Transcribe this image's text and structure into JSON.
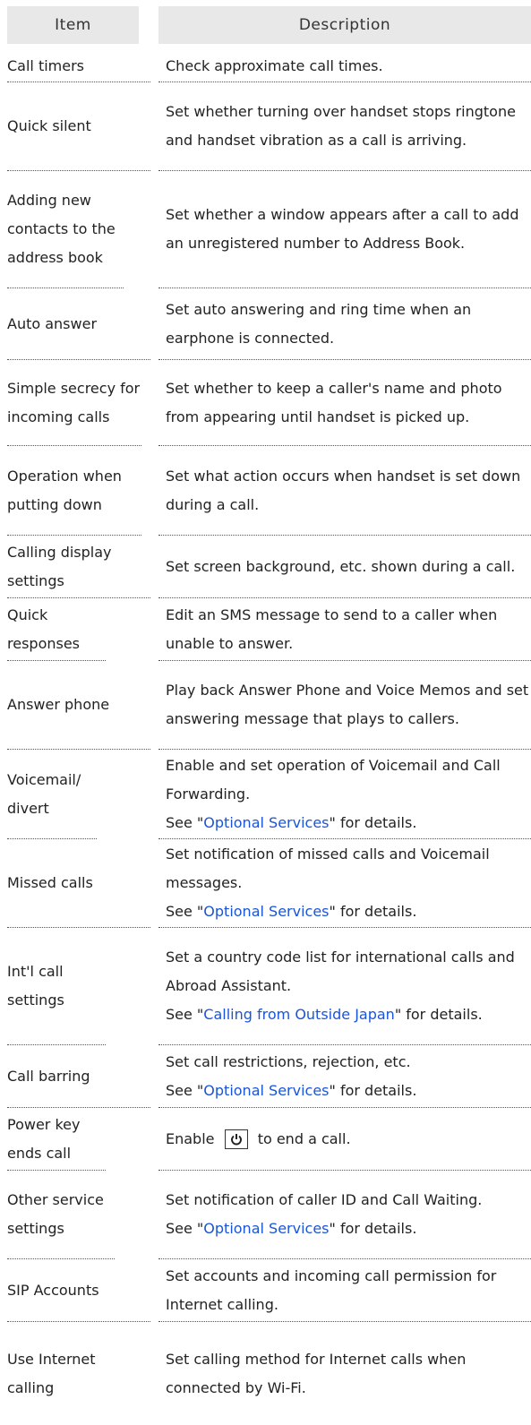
{
  "header": {
    "item": "Item",
    "description": "Description"
  },
  "rows": [
    {
      "item": "Call timers",
      "desc": [
        "Check approximate call times."
      ]
    },
    {
      "item": "Quick silent",
      "desc": [
        "Set whether turning over handset stops ringtone and handset vibration as a call is arriving."
      ]
    },
    {
      "item": "Adding new contacts to the address book",
      "desc": [
        "Set whether a window appears after a call to add an unregistered number to Address Book."
      ]
    },
    {
      "item": "Auto answer",
      "desc": [
        "Set auto answering and ring time when an earphone is connected."
      ]
    },
    {
      "item": "Simple secrecy for incoming calls",
      "desc": [
        "Set whether to keep a caller's name and photo from appearing until handset is picked up."
      ]
    },
    {
      "item": "Operation when putting down",
      "desc": [
        "Set what action occurs when handset is set down during a call."
      ]
    },
    {
      "item": "Calling display settings",
      "desc": [
        "Set screen background, etc. shown during a call."
      ]
    },
    {
      "item": "Quick responses",
      "desc": [
        "Edit an SMS message to send to a caller when unable to answer."
      ]
    },
    {
      "item": "Answer phone",
      "desc": [
        "Play back Answer Phone and Voice Memos and set answering message that plays to callers."
      ]
    },
    {
      "item": "Voicemail/ divert",
      "desc": [
        "Enable and set operation of Voicemail and Call Forwarding."
      ],
      "see": {
        "pre": "See \"",
        "link": "Optional Services",
        "post": "\" for details."
      }
    },
    {
      "item": "Missed calls",
      "desc": [
        "Set notification of missed calls and Voicemail messages."
      ],
      "see": {
        "pre": "See \"",
        "link": "Optional Services",
        "post": "\" for details."
      }
    },
    {
      "item": "Int'l call settings",
      "desc": [
        "Set a country code list for international calls and Abroad Assistant."
      ],
      "see": {
        "pre": "See \"",
        "link": "Calling from Outside Japan",
        "post": "\" for details."
      }
    },
    {
      "item": "Call barring",
      "desc": [
        "Set call restrictions, rejection, etc."
      ],
      "see": {
        "pre": "See \"",
        "link": "Optional Services",
        "post": "\" for details."
      }
    },
    {
      "item": "Power key ends call",
      "key_row": {
        "pre": "Enable",
        "post": "to end a call."
      }
    },
    {
      "item": "Other service settings",
      "desc": [
        "Set notification of caller ID and Call Waiting."
      ],
      "see": {
        "pre": "See \"",
        "link": "Optional Services",
        "post": "\" for details."
      }
    },
    {
      "item": "SIP Accounts",
      "desc": [
        "Set accounts and incoming call permission for Internet calling."
      ]
    },
    {
      "item": "Use Internet calling",
      "desc": [
        "Set calling method for Internet calls when connected by Wi-Fi."
      ]
    }
  ],
  "icons": {
    "power_key": "power-icon"
  },
  "colors": {
    "link": "#1a55d8",
    "header_bg": "#e8e8e8"
  }
}
